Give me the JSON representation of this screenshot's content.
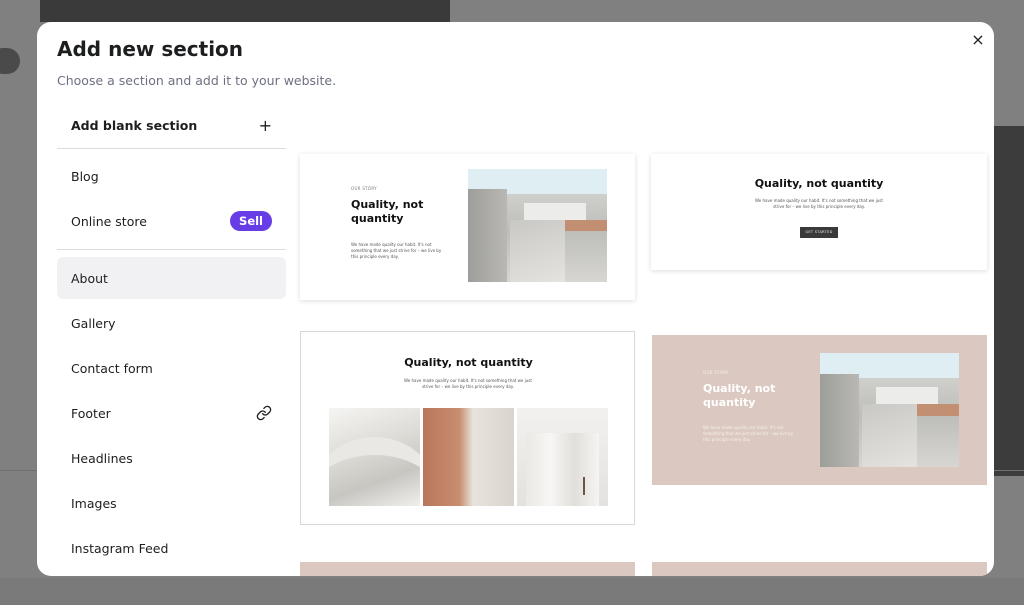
{
  "modal": {
    "title": "Add new section",
    "subtitle": "Choose a section and add it to your website.",
    "close_label": "×"
  },
  "blank_section": {
    "label": "Add blank section",
    "icon": "plus-icon",
    "icon_glyph": "+"
  },
  "menu_top": [
    {
      "label": "Blog"
    },
    {
      "label": "Online store",
      "badge": "Sell"
    }
  ],
  "menu_main": [
    {
      "label": "About",
      "active": true
    },
    {
      "label": "Gallery"
    },
    {
      "label": "Contact form"
    },
    {
      "label": "Footer",
      "icon": "link-icon"
    },
    {
      "label": "Headlines"
    },
    {
      "label": "Images"
    },
    {
      "label": "Instagram Feed"
    }
  ],
  "previews": {
    "card1": {
      "eyebrow": "OUR STORY",
      "heading": "Quality, not quantity",
      "body": "We have made quality our habit. It's not something that we just strive for – we live by this principle every day."
    },
    "card2": {
      "heading": "Quality, not quantity",
      "body": "We have made quality our habit. It's not something that we just strive for – we live by this principle every day.",
      "button": "GET STARTED"
    },
    "card3": {
      "heading": "Quality, not quantity",
      "body": "We have made quality our habit. It's not something that we just strive for – we live by this principle every day."
    },
    "card4": {
      "eyebrow": "OUR STORY",
      "heading": "Quality, not quantity",
      "body": "We have made quality our habit. It's not something that we just strive for – we live by this principle every day.",
      "bg_color": "#dbc9c1"
    }
  },
  "colors": {
    "accent": "#673de6",
    "active_bg": "#f1f1f3"
  }
}
